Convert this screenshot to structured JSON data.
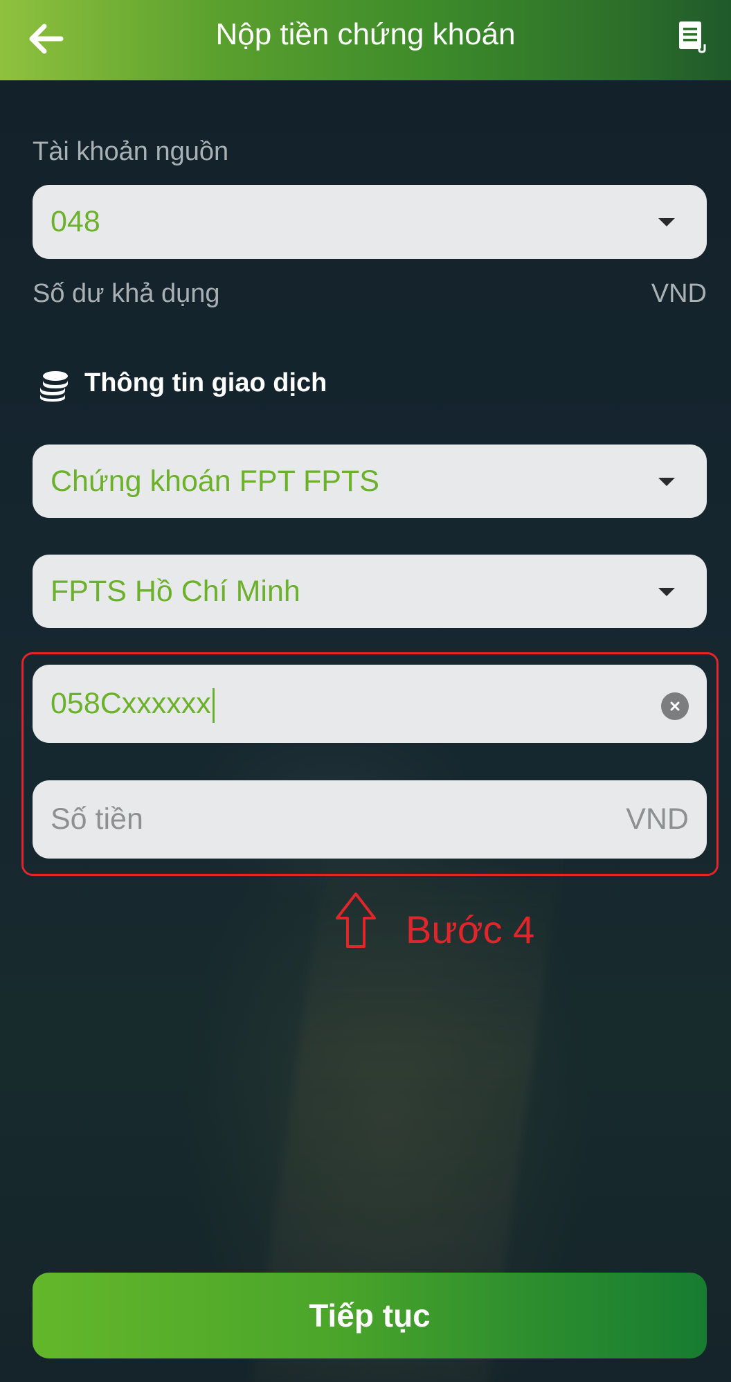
{
  "header": {
    "title": "Nộp tiền chứng khoán",
    "back_icon": "arrow-left-icon",
    "history_icon": "document-icon"
  },
  "source_account": {
    "label": "Tài khoản nguồn",
    "value": "048",
    "balance_label": "Số dư khả dụng",
    "balance_unit": "VND"
  },
  "transaction": {
    "section_title": "Thông tin giao dịch",
    "section_icon": "coins-icon",
    "broker": "Chứng khoán FPT FPTS",
    "branch": "FPTS Hồ Chí Minh",
    "account_number": "058Cxxxxxx",
    "amount_placeholder": "Số tiền",
    "amount_unit": "VND"
  },
  "annotation": {
    "step_label": "Bước 4",
    "color": "#e0262b"
  },
  "footer": {
    "continue_label": "Tiếp tục"
  },
  "colors": {
    "accent_green": "#6cb12b",
    "header_start": "#8fc13e",
    "header_end": "#1f5a2b",
    "background": "#15222a"
  }
}
